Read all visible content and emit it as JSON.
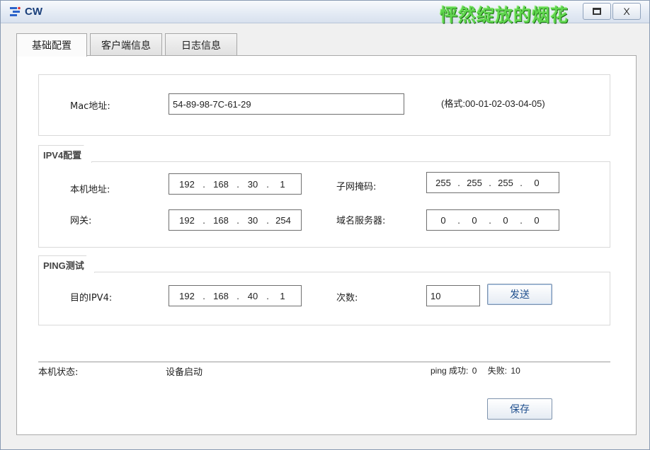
{
  "window": {
    "title": "CW",
    "watermark": "怦然绽放的烟花",
    "close_label": "X"
  },
  "tabs": [
    {
      "label": "基础配置",
      "active": true
    },
    {
      "label": "客户端信息",
      "active": false
    },
    {
      "label": "日志信息",
      "active": false
    }
  ],
  "mac": {
    "label": "Mac地址:",
    "value": "54-89-98-7C-61-29",
    "format_hint": "(格式:00-01-02-03-04-05)"
  },
  "ipv4": {
    "group_title": "IPV4配置",
    "local_label": "本机地址:",
    "local_ip": [
      "192",
      "168",
      "30",
      "1"
    ],
    "mask_label": "子网掩码:",
    "mask": [
      "255",
      "255",
      "255",
      "0"
    ],
    "gateway_label": "网关:",
    "gateway": [
      "192",
      "168",
      "30",
      "254"
    ],
    "dns_label": "域名服务器:",
    "dns": [
      "0",
      "0",
      "0",
      "0"
    ]
  },
  "ping": {
    "group_title": "PING测试",
    "dest_label": "目的IPV4:",
    "dest_ip": [
      "192",
      "168",
      "40",
      "1"
    ],
    "count_label": "次数:",
    "count": "10",
    "send_label": "发送"
  },
  "status": {
    "label": "本机状态:",
    "value": "设备启动",
    "ping_success_label": "ping 成功:",
    "ping_success": "0",
    "ping_fail_label": "失败:",
    "ping_fail": "10"
  },
  "save_label": "保存",
  "colors": {
    "accent": "#1f4f8e",
    "watermark": "#5fd64e"
  }
}
